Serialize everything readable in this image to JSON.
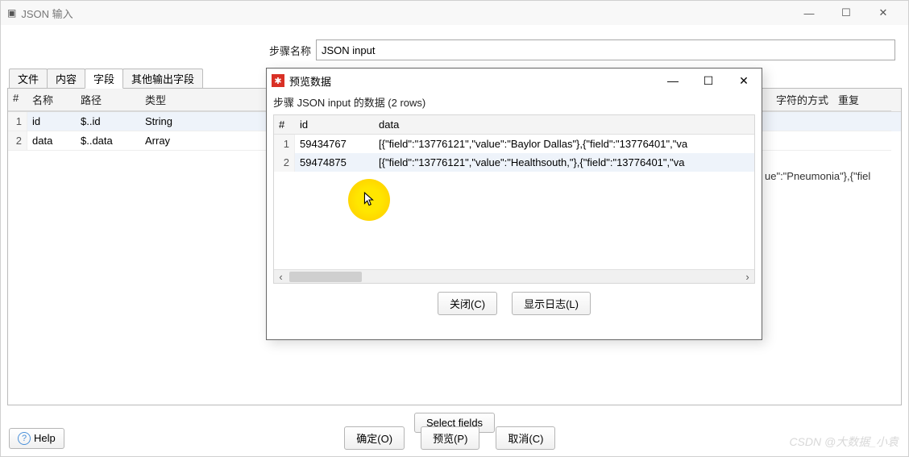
{
  "main": {
    "title": "JSON 输入",
    "step_label": "步骤名称",
    "step_value": "JSON input",
    "tabs": [
      "文件",
      "内容",
      "字段",
      "其他输出字段"
    ],
    "active_tab_index": 2,
    "fields_columns": [
      "#",
      "名称",
      "路径",
      "类型",
      "字符的方式",
      "重复"
    ],
    "fields_rows": [
      {
        "num": "1",
        "name": "id",
        "path": "$..id",
        "type": "String"
      },
      {
        "num": "2",
        "name": "data",
        "path": "$..data",
        "type": "Array"
      }
    ],
    "select_fields_label": "Select fields",
    "buttons": {
      "ok": "确定(O)",
      "preview": "预览(P)",
      "cancel": "取消(C)",
      "help": "Help"
    }
  },
  "preview": {
    "title": "预览数据",
    "subtitle": "步骤 JSON input 的数据  (2 rows)",
    "columns": [
      "#",
      "id",
      "data"
    ],
    "rows": [
      {
        "num": "1",
        "id": "59434767",
        "data": "[{\"field\":\"13776121\",\"value\":\"Baylor Dallas\"},{\"field\":\"13776401\",\"va"
      },
      {
        "num": "2",
        "id": "59474875",
        "data": "[{\"field\":\"13776121\",\"value\":\"Healthsouth,\"},{\"field\":\"13776401\",\"va"
      }
    ],
    "buttons": {
      "close": "关闭(C)",
      "log": "显示日志(L)"
    }
  },
  "bg_overflow_text": "ue\":\"Pneumonia\"},{\"fiel",
  "watermark": "CSDN @大数据_小袁"
}
